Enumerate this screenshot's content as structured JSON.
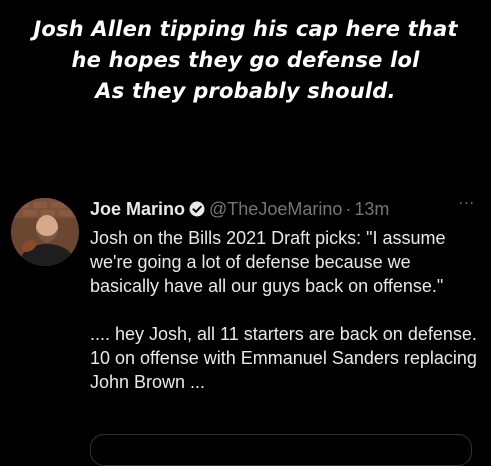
{
  "caption": {
    "line1": "Josh Allen tipping his cap here that",
    "line2": "he hopes they go defense lol",
    "line3": "As they probably should."
  },
  "tweet": {
    "author_name": "Joe Marino",
    "handle": "@TheJoeMarino",
    "separator": "·",
    "time": "13m",
    "more": "···",
    "paragraph1": "Josh on the Bills 2021 Draft picks:  \"I assume we're going a lot of defense because we basically have all our guys back on offense.\"",
    "paragraph2": ".... hey Josh, all 11 starters are back on defense. 10 on offense with Emmanuel Sanders replacing John Brown ...",
    "icons": {
      "avatar": "avatar",
      "verified": "verified-badge-icon",
      "more": "more-options-icon"
    },
    "colors": {
      "background": "#000000",
      "text": "#e7e9ea",
      "muted": "#71767b",
      "border": "#2f3336"
    }
  }
}
